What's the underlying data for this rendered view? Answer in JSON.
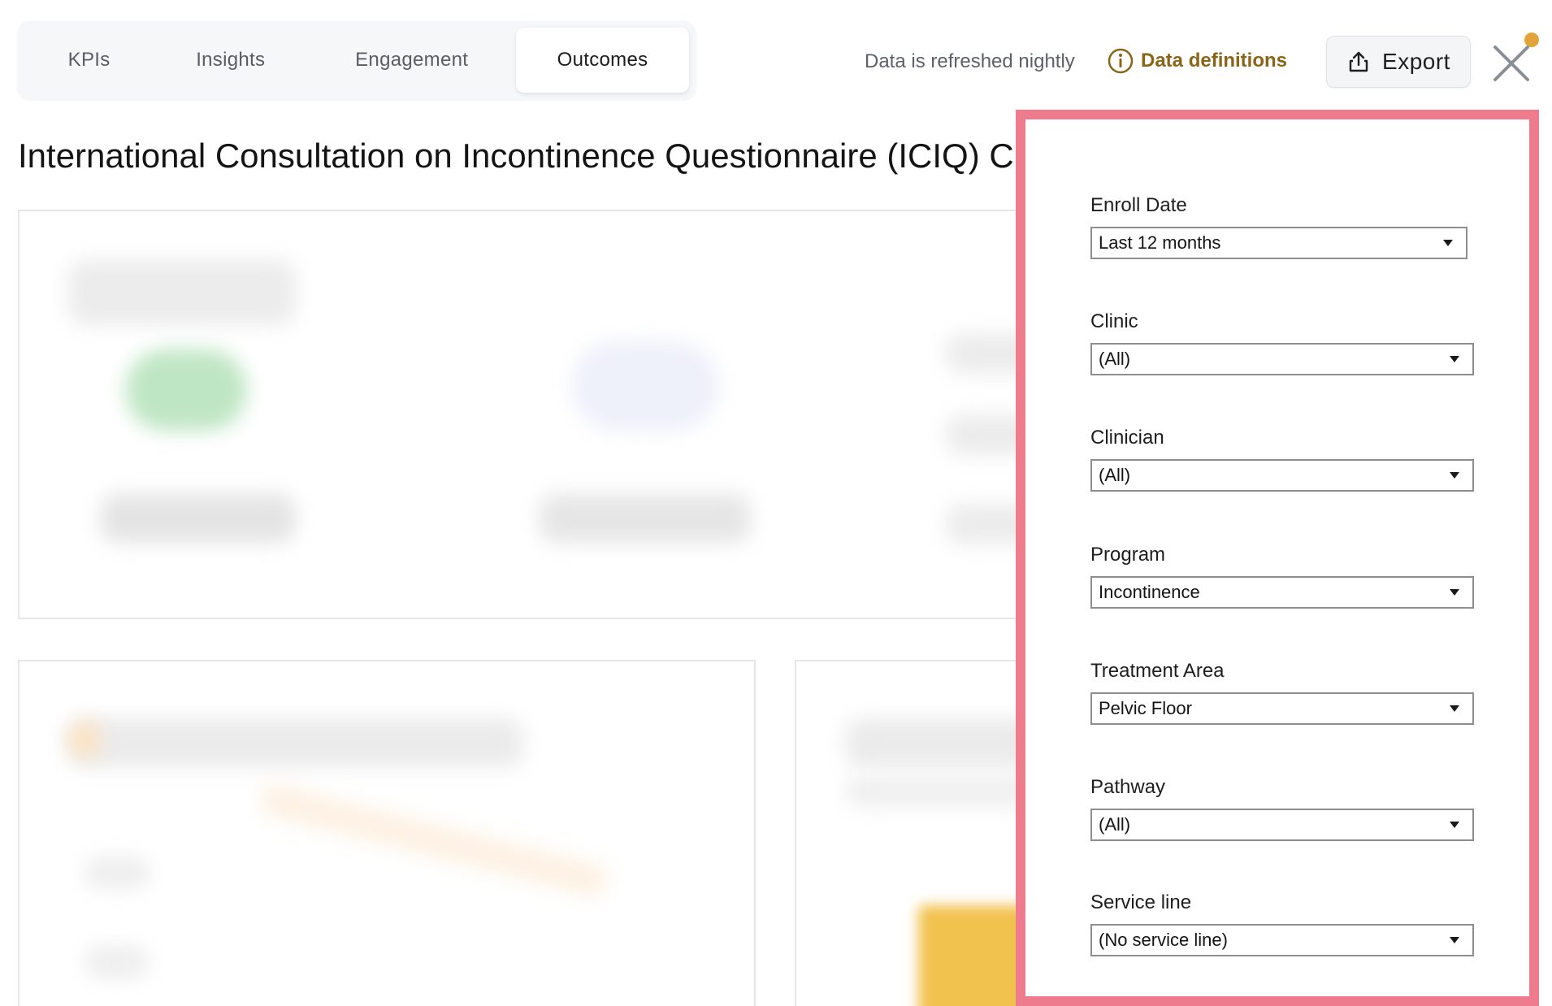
{
  "tabs": [
    {
      "label": "KPIs"
    },
    {
      "label": "Insights"
    },
    {
      "label": "Engagement"
    },
    {
      "label": "Outcomes",
      "active": true
    }
  ],
  "header": {
    "refresh_text": "Data is refreshed nightly",
    "definitions_label": "Data definitions",
    "definitions_icon": "info-circle-icon",
    "export_label": "Export",
    "export_icon": "share-upload-icon",
    "close_icon": "close-icon"
  },
  "page": {
    "title": "International Consultation on Incontinence Questionnaire (ICIQ) C"
  },
  "filters": [
    {
      "label": "Enroll Date",
      "value": "Last 12 months"
    },
    {
      "label": "Clinic",
      "value": "(All)"
    },
    {
      "label": "Clinician",
      "value": "(All)"
    },
    {
      "label": "Program",
      "value": "Incontinence"
    },
    {
      "label": "Treatment Area",
      "value": "Pelvic Floor"
    },
    {
      "label": "Pathway",
      "value": "(All)"
    },
    {
      "label": "Service line",
      "value": "(No service line)"
    }
  ],
  "colors": {
    "panel_border": "#ef7b8f",
    "definitions_accent": "#8a6417",
    "notification_dot": "#e0a43a"
  }
}
